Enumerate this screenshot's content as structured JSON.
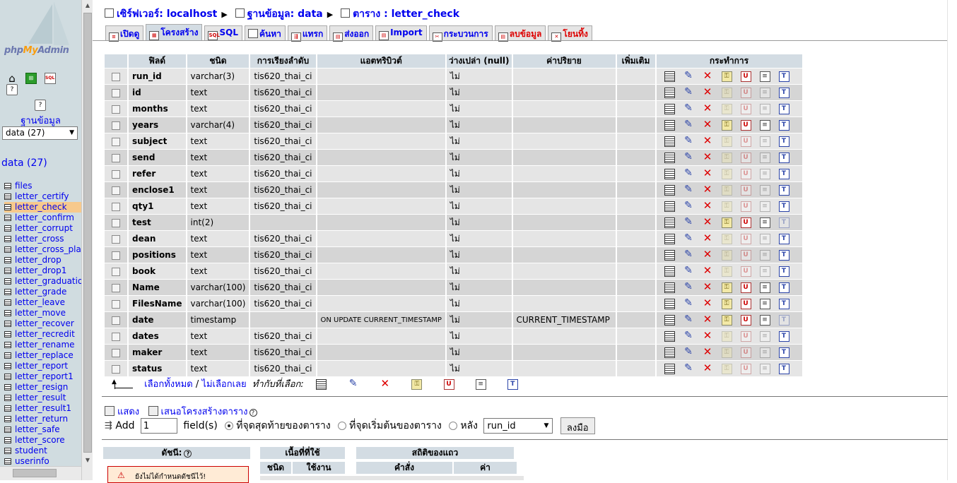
{
  "nav": {
    "logo_php": "php",
    "logo_my": "My",
    "logo_admin": "Admin",
    "icons": [
      "home-icon",
      "query-window-icon",
      "sql-icon",
      "help-icon",
      "docs-icon"
    ],
    "db_heading": "ฐานข้อมูล",
    "db_selected": "data (27)",
    "db_name": "data (27)",
    "tables": [
      "files",
      "letter_certify",
      "letter_check",
      "letter_confirm",
      "letter_corrupt",
      "letter_cross",
      "letter_cross_plac",
      "letter_drop",
      "letter_drop1",
      "letter_graduation",
      "letter_grade",
      "letter_leave",
      "letter_move",
      "letter_recover",
      "letter_recredit",
      "letter_rename",
      "letter_replace",
      "letter_report",
      "letter_report1",
      "letter_resign",
      "letter_result",
      "letter_result1",
      "letter_return",
      "letter_safe",
      "letter_score",
      "student",
      "userinfo"
    ],
    "selected_table": "letter_check"
  },
  "breadcrumb": {
    "server_label": "เซิร์ฟเวอร์: localhost",
    "db_label": "ฐานข้อมูล: data",
    "table_label": "ตาราง : letter_check"
  },
  "tabs": [
    {
      "label": "เปิดดู",
      "icon": "browse-icon"
    },
    {
      "label": "โครงสร้าง",
      "icon": "structure-icon",
      "active": true
    },
    {
      "label": "SQL",
      "icon": "sql-icon"
    },
    {
      "label": "ค้นหา",
      "icon": "search-icon"
    },
    {
      "label": "แทรก",
      "icon": "insert-icon"
    },
    {
      "label": "ส่งออก",
      "icon": "export-icon"
    },
    {
      "label": "Import",
      "icon": "import-icon"
    },
    {
      "label": "กระบวนการ",
      "icon": "operations-icon"
    },
    {
      "label": "ลบข้อมูล",
      "icon": "empty-icon",
      "danger": true
    },
    {
      "label": "โยนทิ้ง",
      "icon": "drop-icon",
      "danger": true
    }
  ],
  "structure": {
    "headers": {
      "field": "ฟิลด์",
      "type": "ชนิด",
      "collation": "การเรียงลำดับ",
      "attributes": "แอตทริบิวต์",
      "null": "ว่างเปล่า (null)",
      "default": "ค่าปริยาย",
      "extra": "เพิ่มเติม",
      "action": "กระทำการ"
    },
    "rows": [
      {
        "field": "run_id",
        "type": "varchar(3)",
        "collation": "tis620_thai_ci",
        "attributes": "",
        "null": "ไม่",
        "default": "",
        "extra": "",
        "primary": true
      },
      {
        "field": "id",
        "type": "text",
        "collation": "tis620_thai_ci",
        "attributes": "",
        "null": "ไม่",
        "default": "",
        "extra": "",
        "primary": false
      },
      {
        "field": "months",
        "type": "text",
        "collation": "tis620_thai_ci",
        "attributes": "",
        "null": "ไม่",
        "default": "",
        "extra": "",
        "primary": false
      },
      {
        "field": "years",
        "type": "varchar(4)",
        "collation": "tis620_thai_ci",
        "attributes": "",
        "null": "ไม่",
        "default": "",
        "extra": "",
        "primary": true
      },
      {
        "field": "subject",
        "type": "text",
        "collation": "tis620_thai_ci",
        "attributes": "",
        "null": "ไม่",
        "default": "",
        "extra": "",
        "primary": false
      },
      {
        "field": "send",
        "type": "text",
        "collation": "tis620_thai_ci",
        "attributes": "",
        "null": "ไม่",
        "default": "",
        "extra": "",
        "primary": false
      },
      {
        "field": "refer",
        "type": "text",
        "collation": "tis620_thai_ci",
        "attributes": "",
        "null": "ไม่",
        "default": "",
        "extra": "",
        "primary": false
      },
      {
        "field": "enclose1",
        "type": "text",
        "collation": "tis620_thai_ci",
        "attributes": "",
        "null": "ไม่",
        "default": "",
        "extra": "",
        "primary": false
      },
      {
        "field": "qty1",
        "type": "text",
        "collation": "tis620_thai_ci",
        "attributes": "",
        "null": "ไม่",
        "default": "",
        "extra": "",
        "primary": false
      },
      {
        "field": "test",
        "type": "int(2)",
        "collation": "",
        "attributes": "",
        "null": "ไม่",
        "default": "",
        "extra": "",
        "primary": true
      },
      {
        "field": "dean",
        "type": "text",
        "collation": "tis620_thai_ci",
        "attributes": "",
        "null": "ไม่",
        "default": "",
        "extra": "",
        "primary": false
      },
      {
        "field": "positions",
        "type": "text",
        "collation": "tis620_thai_ci",
        "attributes": "",
        "null": "ไม่",
        "default": "",
        "extra": "",
        "primary": false
      },
      {
        "field": "book",
        "type": "text",
        "collation": "tis620_thai_ci",
        "attributes": "",
        "null": "ไม่",
        "default": "",
        "extra": "",
        "primary": false
      },
      {
        "field": "Name",
        "type": "varchar(100)",
        "collation": "tis620_thai_ci",
        "attributes": "",
        "null": "ไม่",
        "default": "",
        "extra": "",
        "primary": true
      },
      {
        "field": "FilesName",
        "type": "varchar(100)",
        "collation": "tis620_thai_ci",
        "attributes": "",
        "null": "ไม่",
        "default": "",
        "extra": "",
        "primary": true
      },
      {
        "field": "date",
        "type": "timestamp",
        "collation": "",
        "attributes": "ON UPDATE CURRENT_TIMESTAMP",
        "null": "ไม่",
        "default": "CURRENT_TIMESTAMP",
        "extra": "",
        "primary": true
      },
      {
        "field": "dates",
        "type": "text",
        "collation": "tis620_thai_ci",
        "attributes": "",
        "null": "ไม่",
        "default": "",
        "extra": "",
        "primary": false
      },
      {
        "field": "maker",
        "type": "text",
        "collation": "tis620_thai_ci",
        "attributes": "",
        "null": "ไม่",
        "default": "",
        "extra": "",
        "primary": false
      },
      {
        "field": "status",
        "type": "text",
        "collation": "tis620_thai_ci",
        "attributes": "",
        "null": "ไม่",
        "default": "",
        "extra": "",
        "primary": false
      }
    ]
  },
  "bulk": {
    "check_all": "เลือกทั้งหมด",
    "separator": "/",
    "uncheck_all": "ไม่เลือกเลย",
    "with_selected": "ทำกับที่เลือก:"
  },
  "print": {
    "print_label": "แสดง",
    "propose_label": "เสนอโครงสร้างตาราง"
  },
  "add_fields": {
    "add_label": "Add",
    "count": "1",
    "fields_label": "field(s)",
    "at_end": "ที่จุดสุดท้ายของตาราง",
    "at_begin": "ที่จุดเริ่มต้นของตาราง",
    "after": "หลัง",
    "after_field": "run_id",
    "go": "ลงมือ"
  },
  "indexes": {
    "heading": "ดัชนี:",
    "warning": "ยังไม่ได้กำหนดดัชนีไว้!"
  },
  "space_usage": {
    "heading": "เนื้อที่ที่ใช้",
    "col_type": "ชนิด",
    "col_usage": "ใช้งาน"
  },
  "row_stats": {
    "heading": "สถิติของแถว",
    "col_statement": "คำสั่ง",
    "col_value": "ค่า"
  }
}
